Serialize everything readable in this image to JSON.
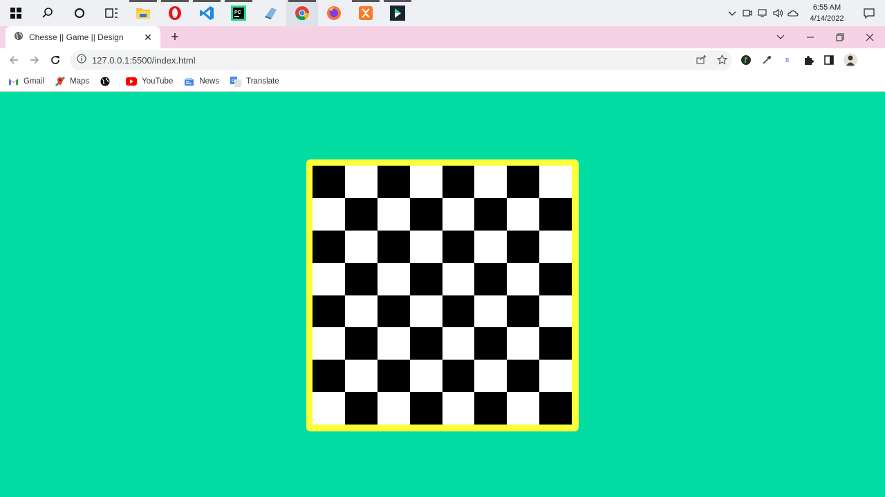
{
  "taskbar": {
    "apps": [
      {
        "name": "windows-start-icon"
      },
      {
        "name": "search-icon"
      },
      {
        "name": "cortana-icon"
      },
      {
        "name": "task-view-icon"
      },
      {
        "name": "file-explorer-icon"
      },
      {
        "name": "opera-icon"
      },
      {
        "name": "vscode-icon"
      },
      {
        "name": "pycharm-icon"
      },
      {
        "name": "notepad-icon"
      },
      {
        "name": "chrome-icon"
      },
      {
        "name": "firefox-icon"
      },
      {
        "name": "xampp-icon"
      },
      {
        "name": "app-icon"
      }
    ],
    "clock": {
      "time": "6:55 AM",
      "date": "4/14/2022"
    }
  },
  "browser": {
    "tab_title": "Chesse || Game || Design",
    "url": "127.0.0.1:5500/index.html",
    "bookmarks": [
      {
        "label": "Gmail",
        "icon": "gmail-icon"
      },
      {
        "label": "Maps",
        "icon": "maps-icon"
      },
      {
        "label": "",
        "icon": "globe-icon"
      },
      {
        "label": "YouTube",
        "icon": "youtube-icon"
      },
      {
        "label": "News",
        "icon": "news-icon"
      },
      {
        "label": "Translate",
        "icon": "translate-icon"
      }
    ]
  },
  "page": {
    "background": "#00dca2",
    "board": {
      "rows": 8,
      "cols": 8,
      "border_color": "#fdff3a",
      "dark_color": "#000000",
      "light_color": "#ffffff",
      "top_left": "dark"
    }
  }
}
